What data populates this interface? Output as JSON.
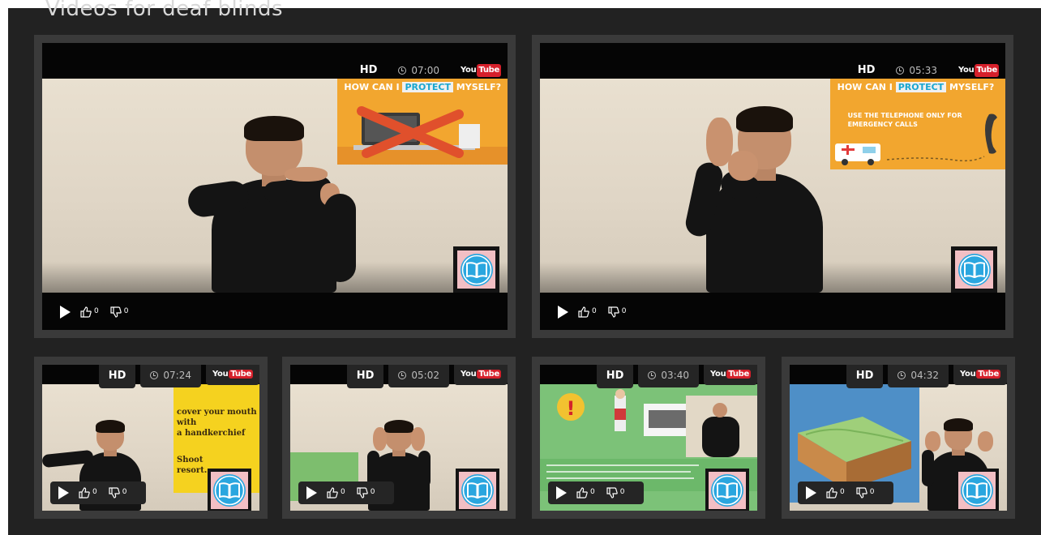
{
  "section": {
    "title": "Videos for deaf blinds"
  },
  "player_labels": {
    "hd": "HD",
    "youtube_you": "You",
    "youtube_tube": "Tube"
  },
  "icons": {
    "play": "play-icon",
    "like": "thumbs-up-icon",
    "dislike": "thumbs-down-icon",
    "clock": "clock-icon",
    "book": "open-book-icon"
  },
  "colors": {
    "panel": "#222222",
    "card": "#3a3a3a",
    "youtube_red": "#d6202b",
    "book_badge": "#f2bfc4",
    "book_icon": "#2aa6df"
  },
  "videos": [
    {
      "duration": "07:00",
      "likes": "0",
      "dislikes": "0",
      "board_title": [
        "HOW CAN I ",
        "PROTECT",
        " MYSELF?"
      ],
      "board_text": ""
    },
    {
      "duration": "05:33",
      "likes": "0",
      "dislikes": "0",
      "board_title": [
        "HOW CAN I ",
        "PROTECT",
        " MYSELF?"
      ],
      "board_text": "USE THE TELEPHONE ONLY FOR EMERGENCY CALLS"
    },
    {
      "duration": "07:24",
      "likes": "0",
      "dislikes": "0",
      "board_lines": [
        "cover your mouth with",
        "a handkerchief",
        "Shoot",
        "resort."
      ]
    },
    {
      "duration": "05:02",
      "likes": "0",
      "dislikes": "0"
    },
    {
      "duration": "03:40",
      "likes": "0",
      "dislikes": "0"
    },
    {
      "duration": "04:32",
      "likes": "0",
      "dislikes": "0"
    }
  ]
}
